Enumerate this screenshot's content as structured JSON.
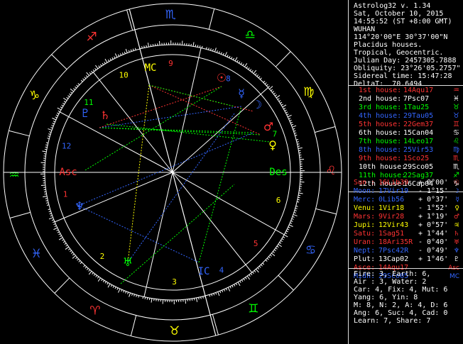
{
  "header": {
    "lines": [
      "Astrolog32 v. 1.34",
      "Sat, October 10, 2015",
      "14:55:52 (ST +8:00 GMT)",
      "WUHAN",
      "114°20'00\"E 30°37'00\"N",
      "Placidus houses.",
      "Tropical, Geocentric.",
      "Julian Day: 2457305.7888",
      "Obliquity: 23°26'05.2757\"",
      "Sidereal time: 15:47:28",
      "DeltaT:  70.6494"
    ]
  },
  "houses": [
    {
      "label": "1st house:",
      "value": "14Aqu17",
      "color": "#ff3333",
      "symbol": "♒"
    },
    {
      "label": "2nd house:",
      "value": "7Psc07",
      "color": "#ffffff",
      "symbol": "♓"
    },
    {
      "label": "3rd house:",
      "value": "1Tau25",
      "color": "#00ff00",
      "symbol": "♉"
    },
    {
      "label": "4th house:",
      "value": "29Tau05",
      "color": "#3366ff",
      "symbol": "♉"
    },
    {
      "label": "5th house:",
      "value": "22Gem37",
      "color": "#ff3333",
      "symbol": "♊"
    },
    {
      "label": "6th house:",
      "value": "15Can04",
      "color": "#ffffff",
      "symbol": "♋"
    },
    {
      "label": "7th house:",
      "value": "14Leo17",
      "color": "#00ff00",
      "symbol": "♌"
    },
    {
      "label": "8th house:",
      "value": "25Vir53",
      "color": "#3366ff",
      "symbol": "♍"
    },
    {
      "label": "9th house:",
      "value": "1Sco25",
      "color": "#ff3333",
      "symbol": "♏"
    },
    {
      "label": "10th house:",
      "value": "29Sco05",
      "color": "#ffffff",
      "symbol": "♏"
    },
    {
      "label": "11th house:",
      "value": "22Sag37",
      "color": "#00ff00",
      "symbol": "♐"
    },
    {
      "label": "12th house:",
      "value": "16Cap04",
      "color": "#ffffff",
      "symbol": "♑"
    }
  ],
  "planets": [
    {
      "label": "Sun :",
      "value": "16Lib39",
      "motion": "+ 0°00'",
      "color": "#ff3333",
      "symbol": "☉"
    },
    {
      "label": "Moon:",
      "value": "17Vir19",
      "motion": "- 1°15'",
      "color": "#3366ff",
      "symbol": "☽"
    },
    {
      "label": "Merc:",
      "value": "0Lib56",
      "motion": "+ 0°37'",
      "color": "#3366ff",
      "symbol": "☿"
    },
    {
      "label": "Venu:",
      "value": "1Vir18",
      "motion": "- 1°52'",
      "color": "#ffff00",
      "symbol": "♀"
    },
    {
      "label": "Mars:",
      "value": "9Vir28",
      "motion": "+ 1°19'",
      "color": "#ff3333",
      "symbol": "♂"
    },
    {
      "label": "Jupi:",
      "value": "12Vir43",
      "motion": "+ 0°57'",
      "color": "#ffff00",
      "symbol": "♃"
    },
    {
      "label": "Satu:",
      "value": "1Sag51",
      "motion": "+ 1°44'",
      "color": "#ff3333",
      "symbol": "♄"
    },
    {
      "label": "Uran:",
      "value": "18Ari35R",
      "motion": "- 0°40'",
      "color": "#ff3333",
      "symbol": "♅"
    },
    {
      "label": "Nept:",
      "value": "7Psc42R",
      "motion": "- 0°49'",
      "color": "#3366ff",
      "symbol": "♆"
    },
    {
      "label": "Plut:",
      "value": "13Cap02",
      "motion": "+ 1°46'",
      "color": "#ffffff",
      "symbol": "♇"
    },
    {
      "label": "Asce:",
      "value": "14Aqu17",
      "motion": "",
      "color": "#ff3333",
      "symbol": "Asc"
    },
    {
      "label": "Midh:",
      "value": "29Sco05",
      "motion": "",
      "color": "#3366ff",
      "symbol": "MC"
    }
  ],
  "stats": [
    "Fire: 3, Earth: 6,",
    "Air : 3, Water: 2",
    "Car: 4, Fix: 4, Mut: 6",
    "Yang: 6, Yin: 8",
    "M: 8, N: 2, A: 4, D: 6",
    "Ang: 6, Suc: 4, Cad: 0",
    "Learn: 7, Share: 7"
  ],
  "wheel": {
    "signs": [
      {
        "glyph": "♑",
        "color": "#3366ff"
      },
      {
        "glyph": "♐",
        "color": "#ff3333"
      },
      {
        "glyph": "♏",
        "color": "#3366ff"
      },
      {
        "glyph": "♎",
        "color": "#00ff00"
      },
      {
        "glyph": "♍",
        "color": "#ffff00"
      },
      {
        "glyph": "♌",
        "color": "#ff3333"
      },
      {
        "glyph": "♋",
        "color": "#3366ff"
      },
      {
        "glyph": "♊",
        "color": "#00ff00"
      },
      {
        "glyph": "♉",
        "color": "#ffff00"
      },
      {
        "glyph": "♈",
        "color": "#ff3333"
      },
      {
        "glyph": "♓",
        "color": "#3366ff"
      },
      {
        "glyph": "♒",
        "color": "#00ff00"
      }
    ],
    "house_numbers": [
      "1",
      "2",
      "3",
      "4",
      "5",
      "6",
      "7",
      "8",
      "9",
      "10",
      "11",
      "12"
    ],
    "asc_label": "Asc",
    "des_label": "Des",
    "mc_label": "MC",
    "ic_label": "IC"
  }
}
